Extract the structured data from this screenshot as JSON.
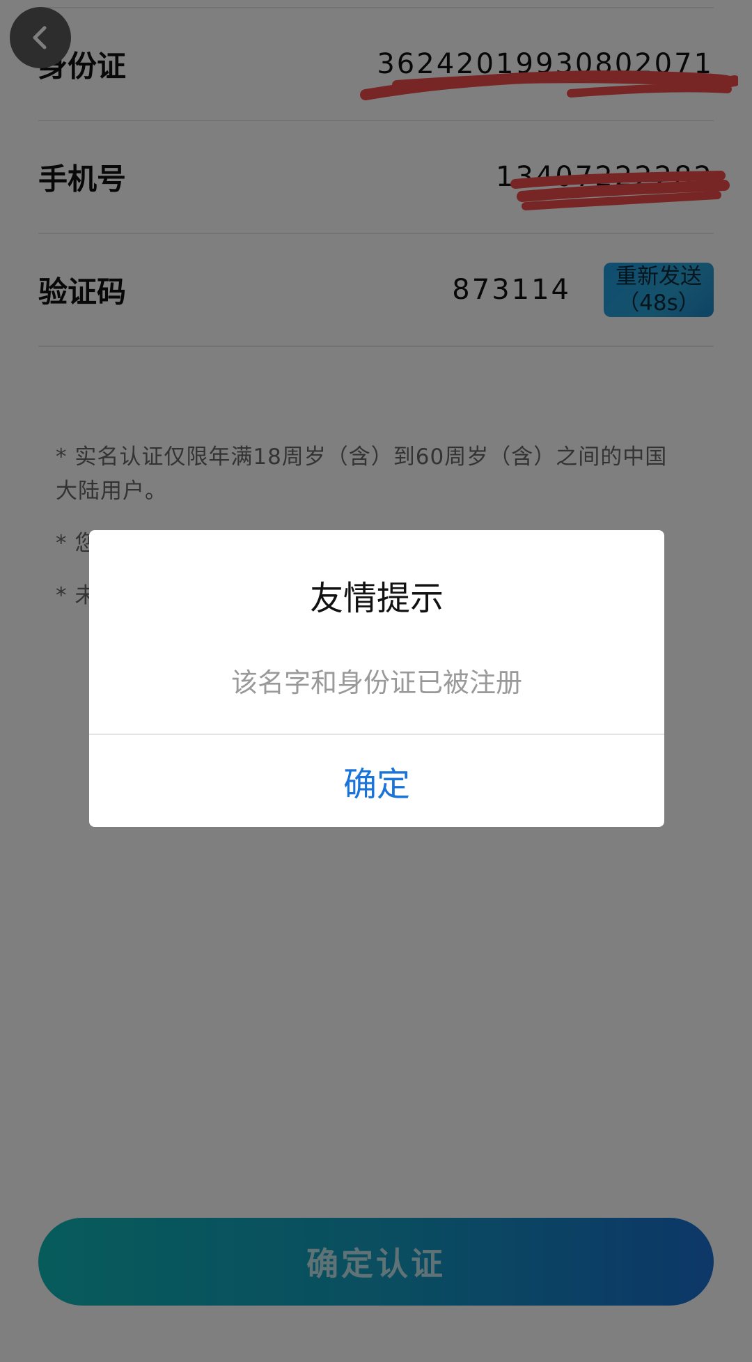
{
  "form": {
    "id_label": "身份证",
    "id_value": "36242019930802071",
    "phone_label": "手机号",
    "phone_value": "13407222282",
    "code_label": "验证码",
    "code_value": "873114",
    "resend_label": "重新发送",
    "resend_countdown": "（48s）"
  },
  "notes": [
    "* 实名认证仅限年满18周岁（含）到60周岁（含）之间的中国大陆用户。",
    "* 您",
    "* 未"
  ],
  "footer": {
    "confirm_label": "确定认证"
  },
  "dialog": {
    "title": "友情提示",
    "message": "该名字和身份证已被注册",
    "ok_label": "确定"
  },
  "colors": {
    "accent_blue": "#1a73d9",
    "scribble_red": "#ef4b4b"
  }
}
